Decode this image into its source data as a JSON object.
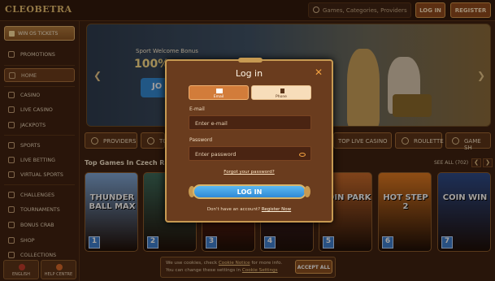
{
  "header": {
    "logo": "CLEOBETRA",
    "search_placeholder": "Games, Categories, Providers",
    "login_label": "LOG IN",
    "register_label": "REGISTER"
  },
  "sidebar": {
    "win_button": "WIN OS TICKETS",
    "items": [
      {
        "label": "PROMOTIONS",
        "icon": "gift-icon"
      },
      {
        "label": "HOME",
        "icon": "home-icon",
        "active": true
      },
      {
        "label": "CASINO",
        "icon": "cards-icon"
      },
      {
        "label": "LIVE CASINO",
        "icon": "live-icon"
      },
      {
        "label": "JACKPOTS",
        "icon": "jackpot-icon"
      },
      {
        "label": "SPORTS",
        "icon": "ball-icon"
      },
      {
        "label": "LIVE BETTING",
        "icon": "live-betting-icon"
      },
      {
        "label": "VIRTUAL SPORTS",
        "icon": "virtual-icon"
      },
      {
        "label": "CHALLENGES",
        "icon": "trophy-icon"
      },
      {
        "label": "TOURNAMENTS",
        "icon": "cup-icon"
      },
      {
        "label": "BONUS CRAB",
        "icon": "crab-icon"
      },
      {
        "label": "SHOP",
        "icon": "shop-icon"
      },
      {
        "label": "COLLECTIONS",
        "icon": "collection-icon"
      }
    ],
    "language_label": "ENGLISH",
    "help_label": "HELP CENTRE"
  },
  "banner": {
    "subtitle": "Sport Welcome Bonus",
    "value": "100%",
    "join_label": "JO"
  },
  "categories": [
    "PROVIDERS",
    "TO",
    "TOP LIVE CASINO",
    "ROULETTE",
    "GAME SH"
  ],
  "games": {
    "title": "Top Games In Czech Rep",
    "see_all": "SEE ALL (702)",
    "items": [
      {
        "name": "THUNDER BALL MAX",
        "num": "1",
        "color": "#7ea8d8"
      },
      {
        "name": "",
        "num": "2",
        "color": "#3a6a5a"
      },
      {
        "name": "",
        "num": "3",
        "color": "#8a2a1a"
      },
      {
        "name": "",
        "num": "4",
        "color": "#4a2a3a"
      },
      {
        "name": "COIN PARK",
        "num": "5",
        "color": "#c86a2a"
      },
      {
        "name": "HOT STEP 2",
        "num": "6",
        "color": "#e07a20"
      },
      {
        "name": "COIN WIN",
        "num": "7",
        "color": "#2a4a8a"
      }
    ]
  },
  "cookie": {
    "text_a": "We use cookies, check",
    "link_a": "Cookie Notice",
    "text_b": "for more info.",
    "text_c": "You can change these settings in",
    "link_b": "Cookie Settings",
    "accept_label": "ACCEPT ALL"
  },
  "login_modal": {
    "title": "Log in",
    "tab_email": "Email",
    "tab_phone": "Phone",
    "email_label": "E-mail",
    "email_placeholder": "Enter e-mail",
    "password_label": "Password",
    "password_placeholder": "Enter password",
    "forgot_link": "Forgot your password?",
    "login_button": "LOG IN",
    "no_account_text": "Don't have an account?",
    "register_link": "Register Now"
  },
  "colors": {
    "background": "#3b1f10",
    "accent_gold": "#c79a52",
    "login_blue": "#2f8ad6",
    "modal_brown": "#6a3c1e"
  }
}
